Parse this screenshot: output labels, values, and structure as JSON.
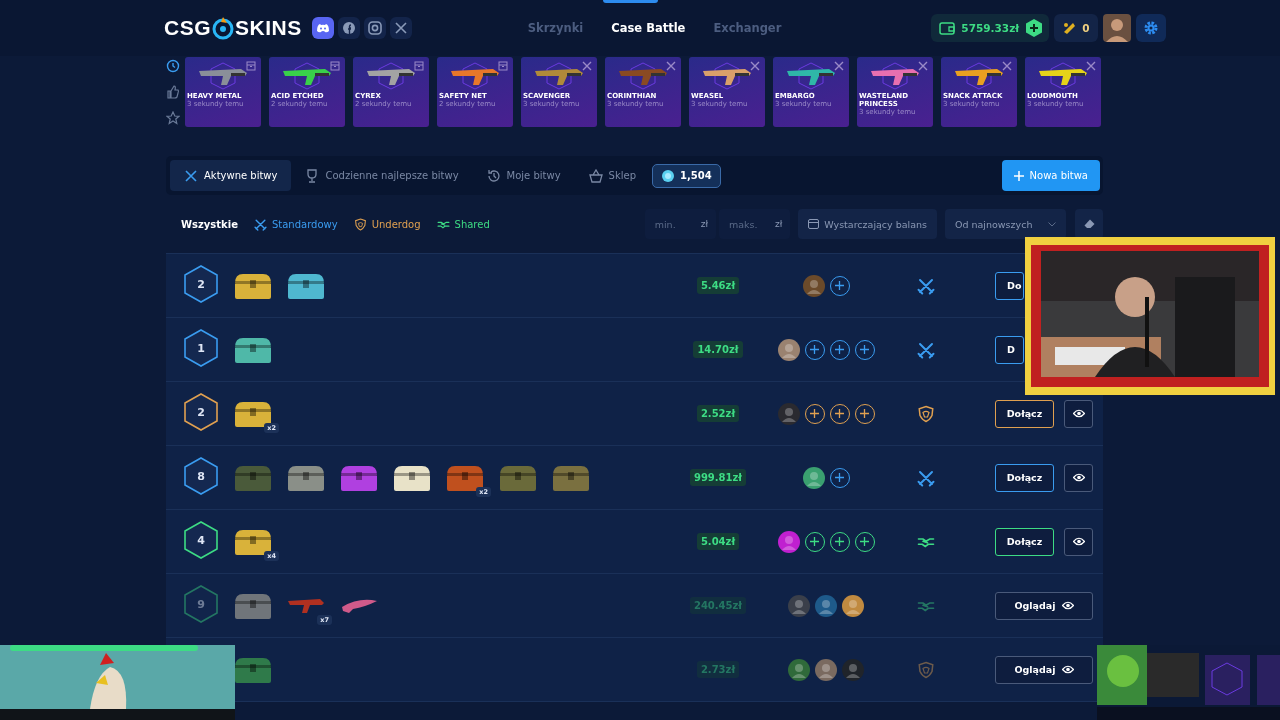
{
  "header": {
    "logo": {
      "left": "CSG",
      "right": "SKINS"
    },
    "nav": [
      {
        "label": "Skrzynki",
        "selected": false
      },
      {
        "label": "Case Battle",
        "selected": true
      },
      {
        "label": "Exchanger",
        "selected": false
      }
    ],
    "balance": "5759.33zł",
    "coins": "0"
  },
  "live_drops": {
    "filters": [
      {
        "kind": "recent",
        "selected": true
      },
      {
        "kind": "liked",
        "selected": false
      },
      {
        "kind": "favorite",
        "selected": false
      }
    ],
    "items": [
      {
        "name": "HEAVY METAL",
        "time": "3 sekundy temu",
        "kind": "case",
        "color": "#8a8f99"
      },
      {
        "name": "ACID ETCHED",
        "time": "2 sekundy temu",
        "kind": "case",
        "color": "#39d14a"
      },
      {
        "name": "CYREX",
        "time": "2 sekundy temu",
        "kind": "case",
        "color": "#a3a3a3"
      },
      {
        "name": "SAFETY NET",
        "time": "2 sekundy temu",
        "kind": "case",
        "color": "#e8772a"
      },
      {
        "name": "SCAVENGER",
        "time": "3 sekundy temu",
        "kind": "battle",
        "color": "#b08a3a"
      },
      {
        "name": "CORINTHIAN",
        "time": "3 sekundy temu",
        "kind": "battle",
        "color": "#8a4a22"
      },
      {
        "name": "WEASEL",
        "time": "3 sekundy temu",
        "kind": "battle",
        "color": "#d9a06a"
      },
      {
        "name": "EMBARGO",
        "time": "3 sekundy temu",
        "kind": "battle",
        "color": "#2fb7a8"
      },
      {
        "name": "WASTELAND PRINCESS",
        "time": "3 sekundy temu",
        "kind": "battle",
        "color": "#e86fb0"
      },
      {
        "name": "SNACK ATTACK",
        "time": "3 sekundy temu",
        "kind": "battle",
        "color": "#e8a020"
      },
      {
        "name": "LOUDMOUTH",
        "time": "3 sekundy temu",
        "kind": "battle",
        "color": "#e6d21a"
      }
    ]
  },
  "tabs": [
    {
      "label": "Aktywne bitwy",
      "selected": true
    },
    {
      "label": "Codzienne najlepsze bitwy",
      "selected": false
    },
    {
      "label": "Moje bitwy",
      "selected": false
    },
    {
      "label": "Sklep",
      "selected": false
    }
  ],
  "gems": "1,504",
  "new_battle_button": "Nowa bitwa",
  "mode_filters": [
    {
      "label": "Wszystkie",
      "kind": "all",
      "selected": true
    },
    {
      "label": "Standardowy",
      "kind": "standard",
      "selected": false
    },
    {
      "label": "Underdog",
      "kind": "underdog",
      "selected": false
    },
    {
      "label": "Shared",
      "kind": "shared",
      "selected": false
    }
  ],
  "min_field": {
    "placeholder": "min.",
    "unit": "zł"
  },
  "max_field": {
    "placeholder": "maks.",
    "unit": "zł"
  },
  "balance_toggle": "Wystarczający balans",
  "sort": "Od najnowszych",
  "battles": [
    {
      "rounds": "2",
      "kind": "standard",
      "in_progress": false,
      "items": [
        {
          "kind": "chest",
          "color": "#d9b23a"
        },
        {
          "kind": "chest",
          "color": "#4fb8d0"
        }
      ],
      "price": "5.46zł",
      "players": [
        {
          "kind": "avatar",
          "color": "#6b4a2a"
        },
        {
          "kind": "slot"
        }
      ],
      "button": {
        "kind": "join",
        "label": "Do"
      },
      "spectate": false
    },
    {
      "rounds": "1",
      "kind": "standard",
      "in_progress": false,
      "items": [
        {
          "kind": "chest",
          "color": "#4fb8a8"
        }
      ],
      "price": "14.70zł",
      "players": [
        {
          "kind": "avatar",
          "color": "#9a8270"
        },
        {
          "kind": "slot"
        },
        {
          "kind": "slot"
        },
        {
          "kind": "slot"
        }
      ],
      "button": {
        "kind": "join",
        "label": "D"
      },
      "spectate": false
    },
    {
      "rounds": "2",
      "kind": "underdog",
      "in_progress": false,
      "items": [
        {
          "kind": "chest",
          "color": "#d9b23a",
          "count": "x2"
        }
      ],
      "price": "2.52zł",
      "players": [
        {
          "kind": "avatar",
          "color": "#2a2a30"
        },
        {
          "kind": "slot"
        },
        {
          "kind": "slot"
        },
        {
          "kind": "slot"
        }
      ],
      "button": {
        "kind": "join",
        "label": "Dołącz"
      },
      "spectate": true
    },
    {
      "rounds": "8",
      "kind": "standard",
      "in_progress": false,
      "items": [
        {
          "kind": "chest",
          "color": "#4a5a3a"
        },
        {
          "kind": "chest",
          "color": "#8a8f88"
        },
        {
          "kind": "chest",
          "color": "#b040e0"
        },
        {
          "kind": "chest",
          "color": "#e8e2c8"
        },
        {
          "kind": "chest",
          "color": "#c0501e",
          "count": "x2"
        },
        {
          "kind": "chest",
          "color": "#6a6a3a"
        },
        {
          "kind": "chest",
          "color": "#7a7040"
        }
      ],
      "price": "999.81zł",
      "players": [
        {
          "kind": "avatar",
          "color": "#3aa070"
        },
        {
          "kind": "slot"
        }
      ],
      "button": {
        "kind": "join",
        "label": "Dołącz"
      },
      "spectate": true
    },
    {
      "rounds": "4",
      "kind": "shared",
      "in_progress": false,
      "items": [
        {
          "kind": "chest",
          "color": "#d9b23a",
          "count": "x4"
        }
      ],
      "price": "5.04zł",
      "players": [
        {
          "kind": "avatar",
          "color": "#c020d0"
        },
        {
          "kind": "slot"
        },
        {
          "kind": "slot"
        },
        {
          "kind": "slot"
        }
      ],
      "button": {
        "kind": "join",
        "label": "Dołącz"
      },
      "spectate": true
    },
    {
      "rounds": "9",
      "kind": "shared",
      "in_progress": true,
      "items": [
        {
          "kind": "chest",
          "color": "#70757a"
        },
        {
          "kind": "gun",
          "color": "#b03020",
          "count": "x7"
        },
        {
          "kind": "knife",
          "color": "#d05a8a"
        }
      ],
      "price": "240.45zł",
      "players": [
        {
          "kind": "avatar",
          "color": "#3a3f4a"
        },
        {
          "kind": "avatar",
          "color": "#1e5a8a"
        },
        {
          "kind": "avatar",
          "color": "#c08a40"
        }
      ],
      "button": {
        "kind": "watch",
        "label": "Oglądaj"
      },
      "spectate": false
    },
    {
      "kind": "underdog",
      "in_progress": true,
      "items": [
        {
          "kind": "chest",
          "color": "#2f7a4a"
        }
      ],
      "price": "2.73zł",
      "players": [
        {
          "kind": "avatar",
          "color": "#2f6a3a"
        },
        {
          "kind": "avatar",
          "color": "#7a6a60"
        },
        {
          "kind": "avatar",
          "color": "#20242a"
        }
      ],
      "button": {
        "kind": "watch",
        "label": "Oglądaj"
      },
      "spectate": false
    }
  ]
}
